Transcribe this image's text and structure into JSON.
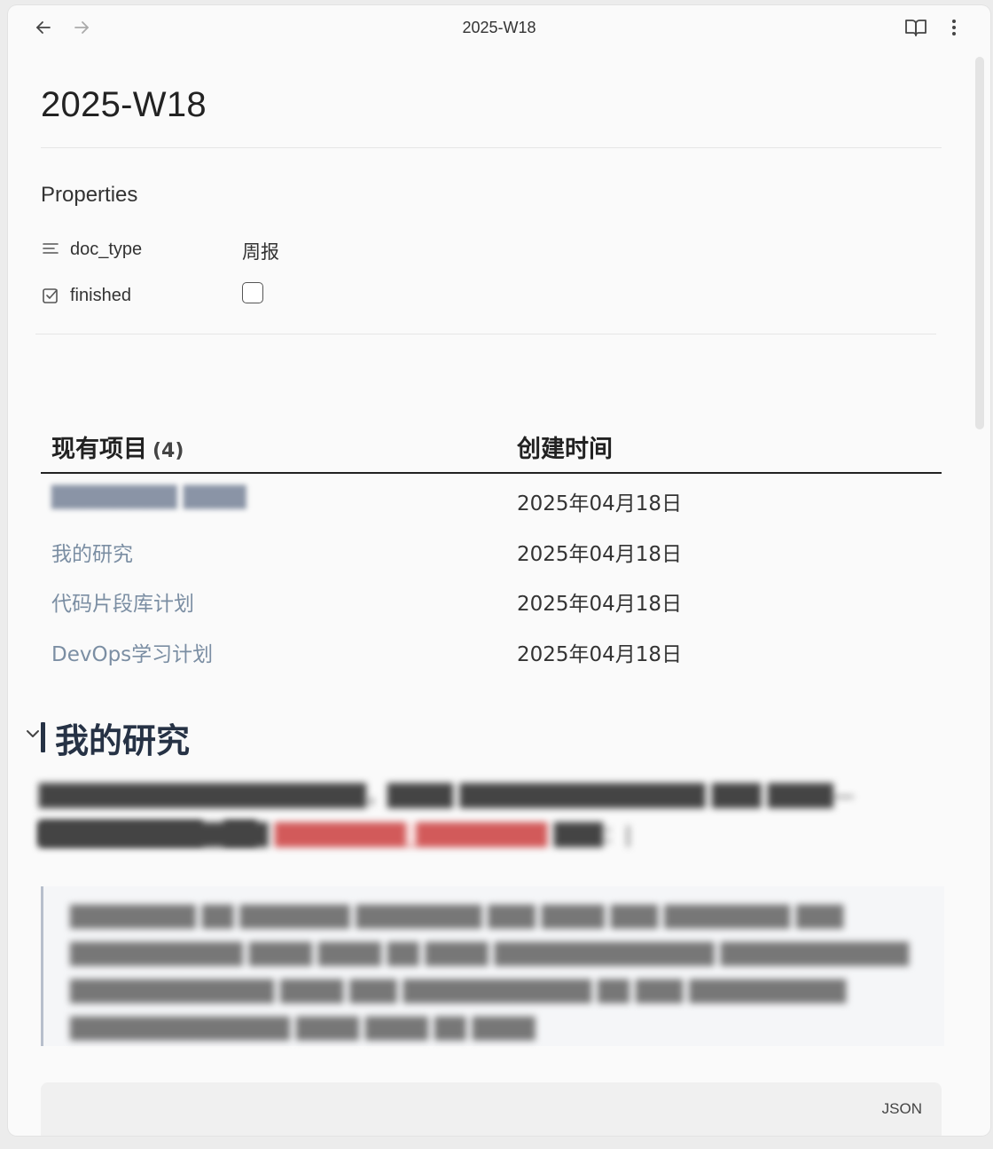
{
  "tab": {
    "title": "2025-W18"
  },
  "toolbar": {
    "back_icon": "arrow-left-icon",
    "forward_icon": "arrow-right-icon",
    "reading_icon": "book-open-icon",
    "more_icon": "more-vertical-icon"
  },
  "page": {
    "title": "2025-W18"
  },
  "properties": {
    "heading": "Properties",
    "items": [
      {
        "key": "doc_type",
        "icon": "text-lines-icon",
        "value": "周报"
      },
      {
        "key": "finished",
        "icon": "checkbox-icon",
        "checked": false
      }
    ]
  },
  "table": {
    "col1": "现有项目",
    "count": "(4)",
    "col2": "创建时间",
    "rows": [
      {
        "name": "████████ ████",
        "date": "2025年04月18日"
      },
      {
        "name": "我的研究",
        "date": "2025年04月18日"
      },
      {
        "name": "代码片段库计划",
        "date": "2025年04月18日"
      },
      {
        "name": "DevOps学习计划",
        "date": "2025年04月18日"
      }
    ]
  },
  "section": {
    "title": "我的研究",
    "para1": "████████████████████，████ ███████████████ ███ ████—██████████，██",
    "para2_a": "██████████████",
    "para2_hl": "████████_████████",
    "para2_b": "███：|",
    "quote": "████████ ██ ███████ ████████ ███ ████ ███ ████████ ███ ███████████ ████ ████ ██ ████ ██████████████ ████████████ █████████████ ████ ███ ████████████ ██ ███ ██████████ ██████████████ ████ ████ ██ ████"
  },
  "code_block": {
    "language": "JSON"
  }
}
